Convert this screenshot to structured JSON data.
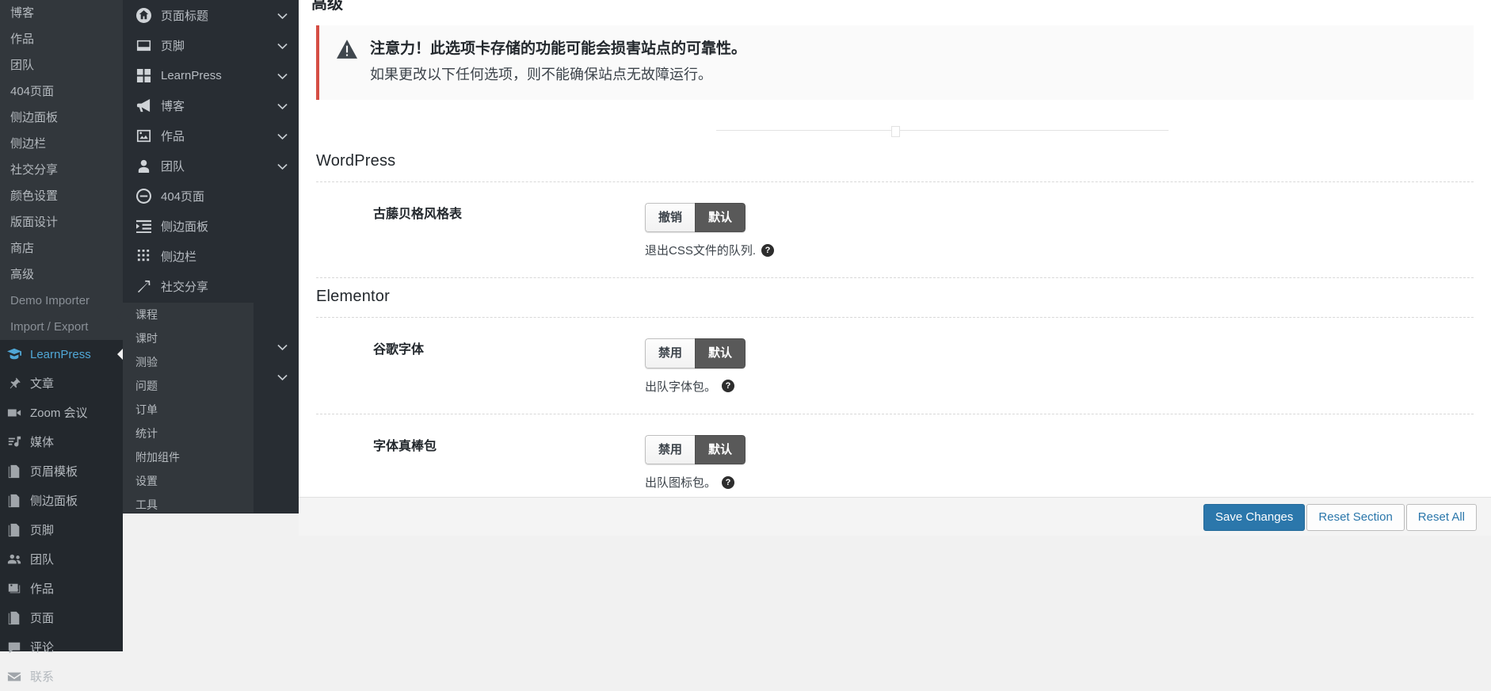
{
  "wp_sidebar": {
    "submenu_items": [
      {
        "label": "博客",
        "dim": false
      },
      {
        "label": "作品",
        "dim": false
      },
      {
        "label": "团队",
        "dim": false
      },
      {
        "label": "404页面",
        "dim": false
      },
      {
        "label": "侧边面板",
        "dim": false
      },
      {
        "label": "侧边栏",
        "dim": false
      },
      {
        "label": "社交分享",
        "dim": false
      },
      {
        "label": "颜色设置",
        "dim": false
      },
      {
        "label": "版面设计",
        "dim": false
      },
      {
        "label": "商店",
        "dim": false
      },
      {
        "label": "高级",
        "dim": false
      },
      {
        "label": "Demo Importer",
        "dim": true
      },
      {
        "label": "Import / Export",
        "dim": true
      }
    ],
    "top_items": [
      {
        "label": "LearnPress",
        "icon": "graduation-cap-icon",
        "current": true
      },
      {
        "label": "文章",
        "icon": "pin-icon",
        "current": false
      },
      {
        "label": "Zoom 会议",
        "icon": "video-camera-icon",
        "current": false
      },
      {
        "label": "媒体",
        "icon": "media-icon",
        "current": false
      },
      {
        "label": "页眉模板",
        "icon": "pages-icon",
        "current": false
      },
      {
        "label": "侧边面板",
        "icon": "pages-icon",
        "current": false
      },
      {
        "label": "页脚",
        "icon": "pages-icon",
        "current": false
      },
      {
        "label": "团队",
        "icon": "users-icon",
        "current": false
      },
      {
        "label": "作品",
        "icon": "gallery-icon",
        "current": false
      },
      {
        "label": "页面",
        "icon": "pages-icon",
        "current": false
      },
      {
        "label": "评论",
        "icon": "comment-icon",
        "current": false
      },
      {
        "label": "联系",
        "icon": "envelope-icon",
        "current": false
      }
    ]
  },
  "redux_nav": {
    "items": [
      {
        "label": "页面标题",
        "icon": "home-icon",
        "chevron": "chevron-down-icon"
      },
      {
        "label": "页脚",
        "icon": "footer-icon",
        "chevron": "chevron-down-icon"
      },
      {
        "label": "LearnPress",
        "icon": "grid-icon",
        "chevron": "chevron-down-icon"
      },
      {
        "label": "博客",
        "icon": "megaphone-icon",
        "chevron": "chevron-down-icon"
      },
      {
        "label": "作品",
        "icon": "image-icon",
        "chevron": "chevron-down-icon"
      },
      {
        "label": "团队",
        "icon": "person-icon",
        "chevron": "chevron-down-icon"
      },
      {
        "label": "404页面",
        "icon": "minus-circle-icon",
        "chevron": ""
      },
      {
        "label": "侧边面板",
        "icon": "indent-icon",
        "chevron": ""
      },
      {
        "label": "侧边栏",
        "icon": "dots-grid-icon",
        "chevron": ""
      },
      {
        "label": "社交分享",
        "icon": "share-arrow-icon",
        "chevron": ""
      },
      {
        "label": "",
        "icon": "",
        "chevron": ""
      },
      {
        "label": "",
        "icon": "",
        "chevron": "chevron-down-icon"
      },
      {
        "label": "",
        "icon": "",
        "chevron": "chevron-down-icon"
      }
    ]
  },
  "learnpress_flyout": {
    "items": [
      {
        "label": "课程"
      },
      {
        "label": "课时"
      },
      {
        "label": "测验"
      },
      {
        "label": "问题"
      },
      {
        "label": "订单"
      },
      {
        "label": "统计"
      },
      {
        "label": "附加组件"
      },
      {
        "label": "设置"
      },
      {
        "label": "工具"
      }
    ]
  },
  "main": {
    "page_title": "高级",
    "notice": {
      "icon": "warning-triangle-icon",
      "headline": "注意力！此选项卡存储的功能可能会损害站点的可靠性。",
      "body": "如果更改以下任何选项，则不能确保站点无故障运行。"
    },
    "sections": [
      {
        "title": "WordPress",
        "rows": [
          {
            "label": "古藤贝格风格表",
            "buttons": [
              {
                "text": "撤销",
                "selected": false
              },
              {
                "text": "默认",
                "selected": true
              }
            ],
            "help_text": "退出CSS文件的队列.",
            "help_icon": "question-mark-icon"
          }
        ]
      },
      {
        "title": "Elementor",
        "rows": [
          {
            "label": "谷歌字体",
            "buttons": [
              {
                "text": "禁用",
                "selected": false
              },
              {
                "text": "默认",
                "selected": true
              }
            ],
            "help_text": "出队字体包。",
            "help_icon": "question-mark-icon"
          },
          {
            "label": "字体真棒包",
            "buttons": [
              {
                "text": "禁用",
                "selected": false
              },
              {
                "text": "默认",
                "selected": true
              }
            ],
            "help_text": "出队图标包。",
            "help_icon": "question-mark-icon"
          }
        ]
      }
    ]
  },
  "footer": {
    "save_label": "Save Changes",
    "reset_section_label": "Reset Section",
    "reset_all_label": "Reset All"
  },
  "colors": {
    "accent_blue": "#0d82bd",
    "primary_button": "#2b77ab",
    "warning_red": "#d54e45",
    "admin_dark": "#23282d",
    "panel_dark": "#282d33"
  }
}
